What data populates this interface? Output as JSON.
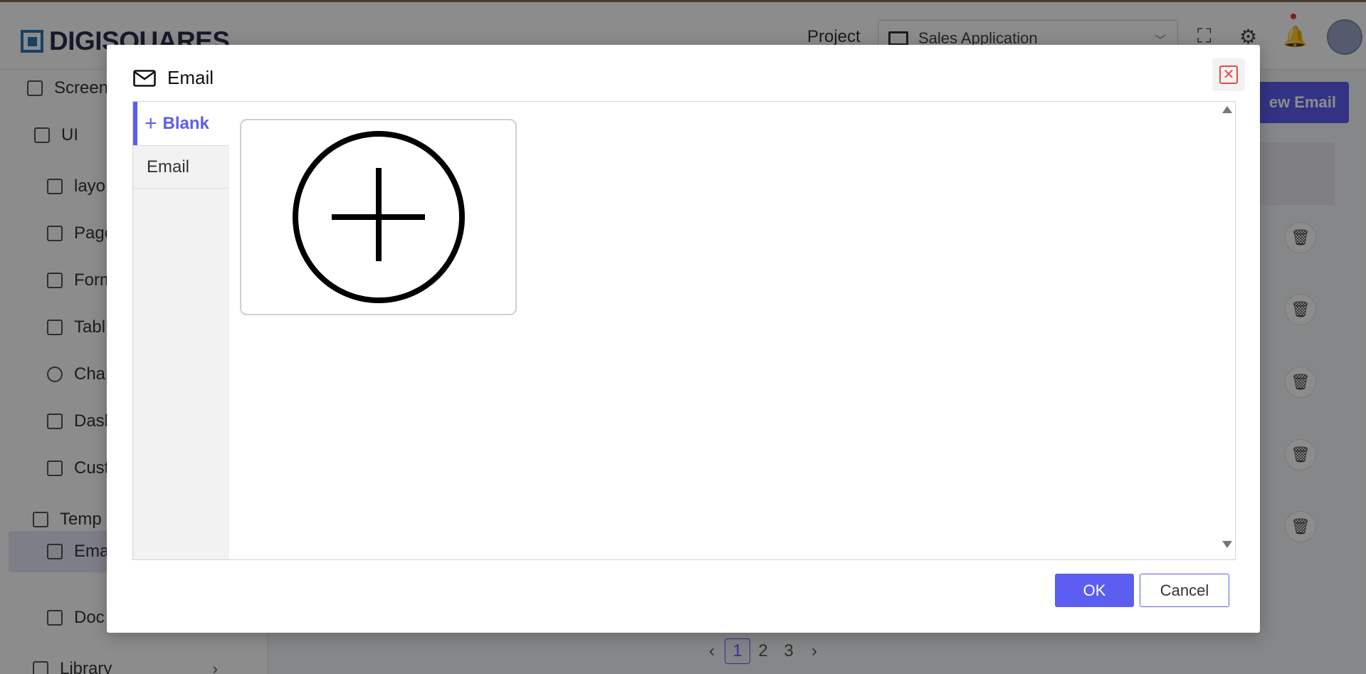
{
  "app": {
    "logo_text": "DIGISQUARES",
    "project_label": "Project",
    "project_value": "Sales Application"
  },
  "sidebar": {
    "items": [
      {
        "label": "Screen"
      },
      {
        "label": "UI"
      },
      {
        "label": "layo"
      },
      {
        "label": "Page"
      },
      {
        "label": "Form"
      },
      {
        "label": "Tabl"
      },
      {
        "label": "Cha"
      },
      {
        "label": "Dash"
      },
      {
        "label": "Cust"
      },
      {
        "label": "Temp"
      },
      {
        "label": "Ema"
      },
      {
        "label": "Doc"
      },
      {
        "label": "Library"
      }
    ]
  },
  "main": {
    "new_button_label": "ew Email",
    "pagination": [
      "1",
      "2",
      "3"
    ],
    "pagination_prev": "‹",
    "pagination_next": "›"
  },
  "modal": {
    "title": "Email",
    "close_symbol": "✕",
    "categories": [
      {
        "label": "Blank",
        "icon": "plus-icon",
        "active": true
      },
      {
        "label": "Email",
        "active": false
      }
    ],
    "templates": [
      {
        "icon": "add-circle-icon"
      }
    ],
    "ok_label": "OK",
    "cancel_label": "Cancel"
  },
  "colors": {
    "accent": "#5b5ef0",
    "close_red": "#e24c4c",
    "logo_blue": "#2a77b8"
  }
}
